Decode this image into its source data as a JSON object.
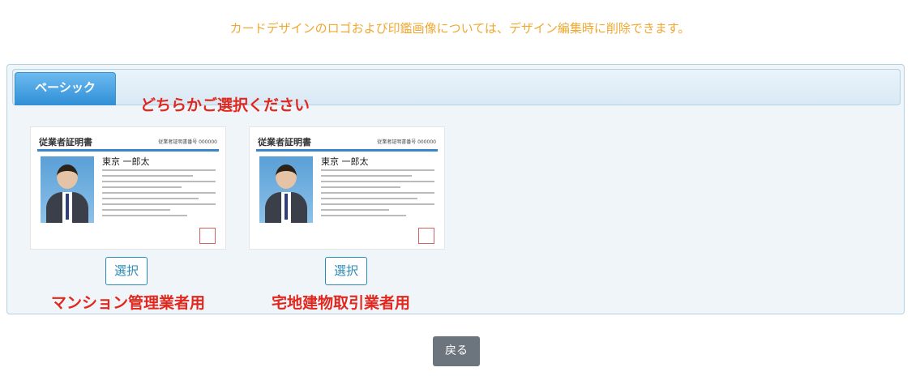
{
  "notice": "カードデザインのロゴおよび印鑑画像については、デザイン編集時に削除できます。",
  "tab_label": "ベーシック",
  "prompt": "どちらかご選択ください",
  "cards": [
    {
      "card_title": "従業者証明書",
      "card_number_label": "従業者証明書番号 000000",
      "person_name": "東京 一郎太",
      "select_label": "選択",
      "caption": "マンション管理業者用"
    },
    {
      "card_title": "従業者証明書",
      "card_number_label": "従業者証明書番号 000000",
      "person_name": "東京 一郎太",
      "select_label": "選択",
      "caption": "宅地建物取引業者用"
    }
  ],
  "back_label": "戻る",
  "colors": {
    "notice": "#f0a830",
    "tab": "#2f8fd6",
    "prompt": "#e0281e",
    "select_border": "#2a8ab6",
    "back_button": "#6c757d"
  }
}
